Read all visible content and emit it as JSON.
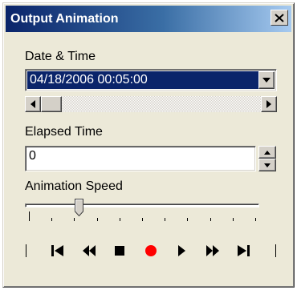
{
  "window": {
    "title": "Output Animation"
  },
  "datetime": {
    "label": "Date & Time",
    "value": "04/18/2006 00:05:00"
  },
  "elapsed": {
    "label": "Elapsed Time",
    "value": "0"
  },
  "speed": {
    "label": "Animation Speed",
    "level": 0.22,
    "tick_count": 11
  },
  "controls": [
    {
      "name": "go-to-start-button",
      "icon": "skip-to-start-icon",
      "color": "#000000"
    },
    {
      "name": "rewind-button",
      "icon": "fast-rewind-icon",
      "color": "#000000"
    },
    {
      "name": "stop-button",
      "icon": "stop-icon",
      "color": "#000000"
    },
    {
      "name": "record-button",
      "icon": "record-icon",
      "color": "#ff0000"
    },
    {
      "name": "play-button",
      "icon": "play-icon",
      "color": "#000000"
    },
    {
      "name": "fast-forward-button",
      "icon": "fast-forward-icon",
      "color": "#000000"
    },
    {
      "name": "go-to-end-button",
      "icon": "skip-to-end-icon",
      "color": "#000000"
    }
  ],
  "colors": {
    "title_gradient_start": "#0a246a",
    "title_gradient_end": "#a6caf0",
    "selection": "#0a246a",
    "dialog_face": "#ece9d8",
    "record": "#ff0000"
  }
}
